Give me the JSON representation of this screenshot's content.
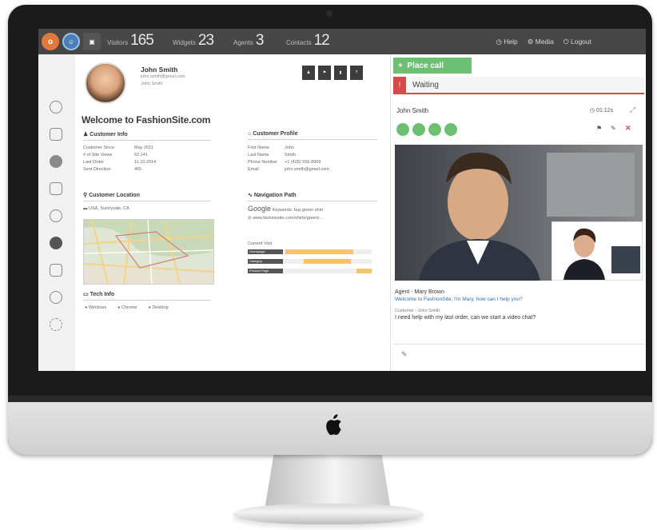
{
  "topbar": {
    "stats": [
      {
        "label": "Visitors",
        "value": "165"
      },
      {
        "label": "Widgets",
        "value": "23"
      },
      {
        "label": "Agents",
        "value": "3"
      },
      {
        "label": "Contacts",
        "value": "12"
      }
    ],
    "links": [
      "Help",
      "Media",
      "Logout"
    ]
  },
  "profile": {
    "name": "John Smith",
    "email": "john.smith@gmail.com",
    "phone": "John Smith",
    "welcome": "Welcome to FashionSite.com"
  },
  "customer_info": {
    "title": "Customer Info",
    "rows": [
      {
        "k": "Customer Since",
        "v": "May 2011"
      },
      {
        "k": "# of Site Views",
        "v": "52,141"
      },
      {
        "k": "Last Order",
        "v": "11.10.2014"
      },
      {
        "k": "Sent Direction",
        "v": "465"
      }
    ]
  },
  "customer_profile": {
    "title": "Customer Profile",
    "rows": [
      {
        "k": "First Name",
        "v": "John"
      },
      {
        "k": "Last Name",
        "v": "Smith"
      },
      {
        "k": "Phone Number",
        "v": "+1 (425) 556-8909"
      },
      {
        "k": "Email",
        "v": "john.smith@gmail.com"
      }
    ]
  },
  "location": {
    "title": "Customer Location",
    "place": "USA, Sunnyvale, CA"
  },
  "navigation": {
    "title": "Navigation Path",
    "google_label": "Google",
    "keywords": "Keywords: buy green shirt",
    "url": "www.fashionsite.com/shirts/green/...",
    "funnel_label": "Current Visit",
    "bars": [
      {
        "label": "Homepage",
        "fill": 0.55,
        "start": 0.3
      },
      {
        "label": "Category",
        "fill": 0.38,
        "start": 0.45
      },
      {
        "label": "Product Page",
        "fill": 0.12,
        "start": 0.88
      }
    ]
  },
  "tech": {
    "title": "Tech Info",
    "items": [
      "Windows",
      "Chrome",
      "Desktop"
    ]
  },
  "right": {
    "place_call": "Place call",
    "waiting": "Waiting",
    "chat_name": "John Smith",
    "timer": "01:12s",
    "agent_line": "Agent - Mary Brown",
    "agent_msg": "Welcome to FashionSite, I'm Mary, how can I help you?",
    "customer_line": "Customer - John Smith",
    "customer_msg": "I need help with my last order, can we start a video chat?"
  }
}
